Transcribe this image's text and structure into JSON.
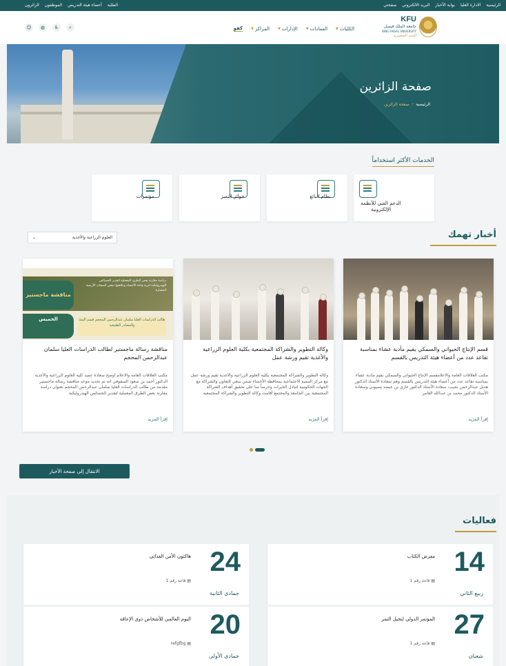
{
  "topbar": {
    "right_links": [
      "الرئيسية",
      "الادارة العليا",
      "بوابة الأخبار",
      "البريد الالكتروني",
      "صفحتي"
    ],
    "left_links": [
      "الطلبة",
      "أعضاء هيئة التدريس",
      "الموظفون",
      "الزائرون"
    ]
  },
  "header": {
    "logo": {
      "abbr": "KFU",
      "name_ar": "جامعة الملك فيصل",
      "name_en": "KING FAISAL UNIVERSITY",
      "tagline": "السنة التحضيرية"
    },
    "nav": [
      "الكليات",
      "العمادات",
      "الإدارات",
      "المراكز",
      "كفو"
    ],
    "icons": [
      "search-icon",
      "accessibility-icon",
      "globe-icon",
      "user-icon"
    ]
  },
  "hero": {
    "title": "صفحة الزائرين",
    "breadcrumb": {
      "home": "الرئيسية",
      "separator": "•",
      "current": "صفحة الزائرين"
    }
  },
  "services": {
    "title": "الخدمات الأكثر استخداماً",
    "items": [
      {
        "label": "الدعم الفني للأنظمة الإلكترونية",
        "icon": "tools-icon"
      },
      {
        "label": "نظام البائع",
        "icon": "vendor-icon"
      },
      {
        "label": "جوائز التميز",
        "icon": "award-certificate-icon"
      },
      {
        "label": "مؤتمرات",
        "icon": "conference-icon"
      }
    ]
  },
  "news": {
    "title": "أخبار تهمك",
    "filter_value": "العلوم الزراعية والأغذية",
    "cards": [
      {
        "title": "قسم الإنتاج الحيواني والسمكي يقيم مأدبة عشاء بمناسبة تقاعد عدد من أعضاء هيئة التدريس بالقسم",
        "body": "مكتب العلاقات العامة والاعلامقسم الإنتاج الحيواني والسمكي يقيم مأدبة عشاء بمناسبة تقاعد عدد من أعضاء هيئة التدريس بالقسم وهم سعادة الأستاذ الدكتور هذيل عبدالرحمن نجيب، سعادة الأستاذ الدكتور غازي بن عيضه بسيوني وسعادة الأستاذ الدكتور محمد بن عبدالله العامر",
        "more": "إقرأ المزيد"
      },
      {
        "title": "وكالة التطوير والشراكة المجتمعية بكلية العلوم الزراعية والأغذية تقيم ورشة عمل",
        "body": "وكالة التطوير والشراكة المجتمعية بكلية العلوم الزراعية والأغذية تقيم ورشة عمل مع مركز التنمية الاجتماعية بمحافظة الأحساء ضمن سعي التعاون والشراكة مع الجهات الحكومية لتبادل الخبرات وحرصاً منا على تحقيق أهداف الشراكة المجتمعية بين الجامعة والمجتمع أقامت وكالة التطوير والشراكة المجتمعية",
        "more": "إقرأ المزيد"
      },
      {
        "title": "مناقشة رسالة ماجستير لطالب الدراسات العليا سلمان عبدالرحمن المحجم",
        "body": "مكتب العلاقات العامة والاعلام اوضح سعادة عميد كلية العلوم الزراعية والأغذية الدكتور أحمد بن سعود السقوفي انه تم تحديد موعد مناقشة رسالة ماجستير مقدمة من طالب الدراسات العليا سلمان عبدالرحمن المحجم بعنوان دراسة مقارنة بعض الطرق المعملية لتقدير الخصائص الهيدروليكية",
        "more": "إقرأ المزيد",
        "poster": {
          "badge": "مناقشة ماجستير",
          "day": "الخميس",
          "text": "دراسة مقارنة بعض الطرق المعملية لتقدير الخصائص الهيدروليكية لتربة واحة الأحساء وعلاقتها ببعض الصفات الأرضية المختارة",
          "student": "طالب الدراسات العليا سلمان عبدالرحمن المحجم قسم البيئة والمصادر الطبيعية"
        }
      }
    ],
    "button": "الانتقال إلى صفحة الأخبار"
  },
  "events": {
    "title": "فعاليات",
    "items": [
      {
        "day": "14",
        "month": "ربيع الثاني",
        "name": "معرض الكتاب",
        "location": "قاعة رقم 1"
      },
      {
        "day": "24",
        "month": "جمادى الثانية",
        "name": "هاكثون الأمن الغذائي",
        "location": "قاعة رقم 1"
      },
      {
        "day": "27",
        "month": "شعبان",
        "name": "المؤتمر الدولي لنخيل التمر",
        "location": "قاعة رقم 1"
      },
      {
        "day": "20",
        "month": "جمادى الأولى",
        "name": "اليوم العالمي للأشخاص ذوي الإعاقة",
        "location": "refgfbg"
      }
    ]
  },
  "colors": {
    "primary": "#1d5a5e",
    "accent": "#c49a3a"
  }
}
